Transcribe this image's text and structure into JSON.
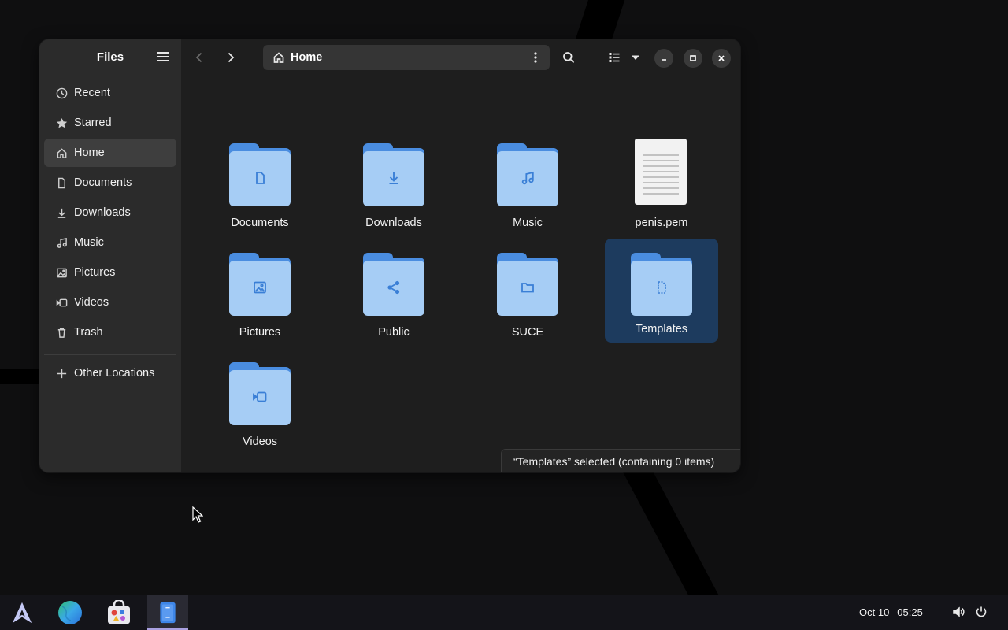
{
  "sidebar": {
    "title": "Files",
    "items": [
      {
        "label": "Recent",
        "icon": "clock-icon"
      },
      {
        "label": "Starred",
        "icon": "star-icon"
      },
      {
        "label": "Home",
        "icon": "home-icon",
        "active": true
      },
      {
        "label": "Documents",
        "icon": "document-icon"
      },
      {
        "label": "Downloads",
        "icon": "download-icon"
      },
      {
        "label": "Music",
        "icon": "music-icon"
      },
      {
        "label": "Pictures",
        "icon": "image-icon"
      },
      {
        "label": "Videos",
        "icon": "video-icon"
      },
      {
        "label": "Trash",
        "icon": "trash-icon"
      }
    ],
    "other_locations": "Other Locations"
  },
  "toolbar": {
    "path": "Home"
  },
  "files": [
    {
      "name": "Documents",
      "kind": "folder",
      "glyph": "document-icon"
    },
    {
      "name": "Downloads",
      "kind": "folder",
      "glyph": "download-icon"
    },
    {
      "name": "Music",
      "kind": "folder",
      "glyph": "music-icon"
    },
    {
      "name": "penis.pem",
      "kind": "text-file",
      "glyph": "text-file-icon"
    },
    {
      "name": "Pictures",
      "kind": "folder",
      "glyph": "image-icon"
    },
    {
      "name": "Public",
      "kind": "folder",
      "glyph": "share-icon"
    },
    {
      "name": "SUCE",
      "kind": "folder",
      "glyph": "folder-icon"
    },
    {
      "name": "Templates",
      "kind": "folder",
      "glyph": "template-icon",
      "selected": true
    },
    {
      "name": "Videos",
      "kind": "folder",
      "glyph": "video-icon"
    }
  ],
  "status": "“Templates” selected  (containing 0 items)",
  "taskbar": {
    "date": "Oct 10",
    "time": "05:25"
  },
  "colors": {
    "folder_tab": "#4a8de0",
    "folder_body": "#a6cdf5",
    "selection": "#1d3b5e",
    "taskbar_active": "#a9a0e0"
  }
}
